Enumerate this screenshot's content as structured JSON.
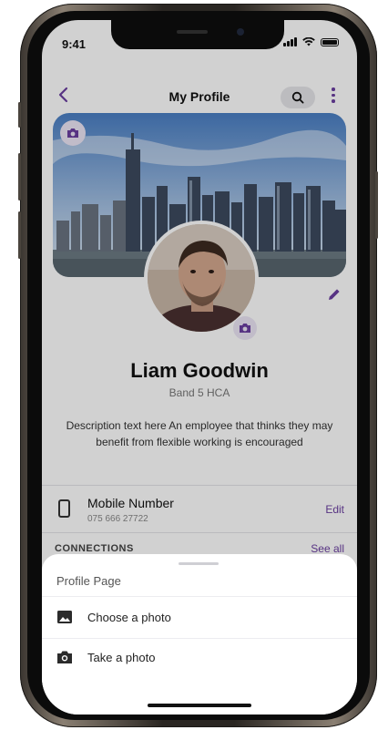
{
  "status_bar": {
    "time": "9:41"
  },
  "header": {
    "title": "My Profile"
  },
  "profile": {
    "name": "Liam Goodwin",
    "role": "Band 5 HCA",
    "description": "Description text here An employee that thinks they may benefit from flexible working is encouraged"
  },
  "contact": {
    "mobile_label": "Mobile Number",
    "mobile_value": "075 666 27722",
    "edit_label": "Edit"
  },
  "connections": {
    "label": "CONNECTIONS",
    "see_all_label": "See all"
  },
  "sheet": {
    "title": "Profile Page",
    "items": [
      {
        "label": "Choose a photo",
        "icon": "image-icon"
      },
      {
        "label": "Take a photo",
        "icon": "camera-icon"
      }
    ]
  },
  "colors": {
    "accent": "#6b3fa0",
    "overlay": "rgba(0,0,0,0.18)"
  }
}
